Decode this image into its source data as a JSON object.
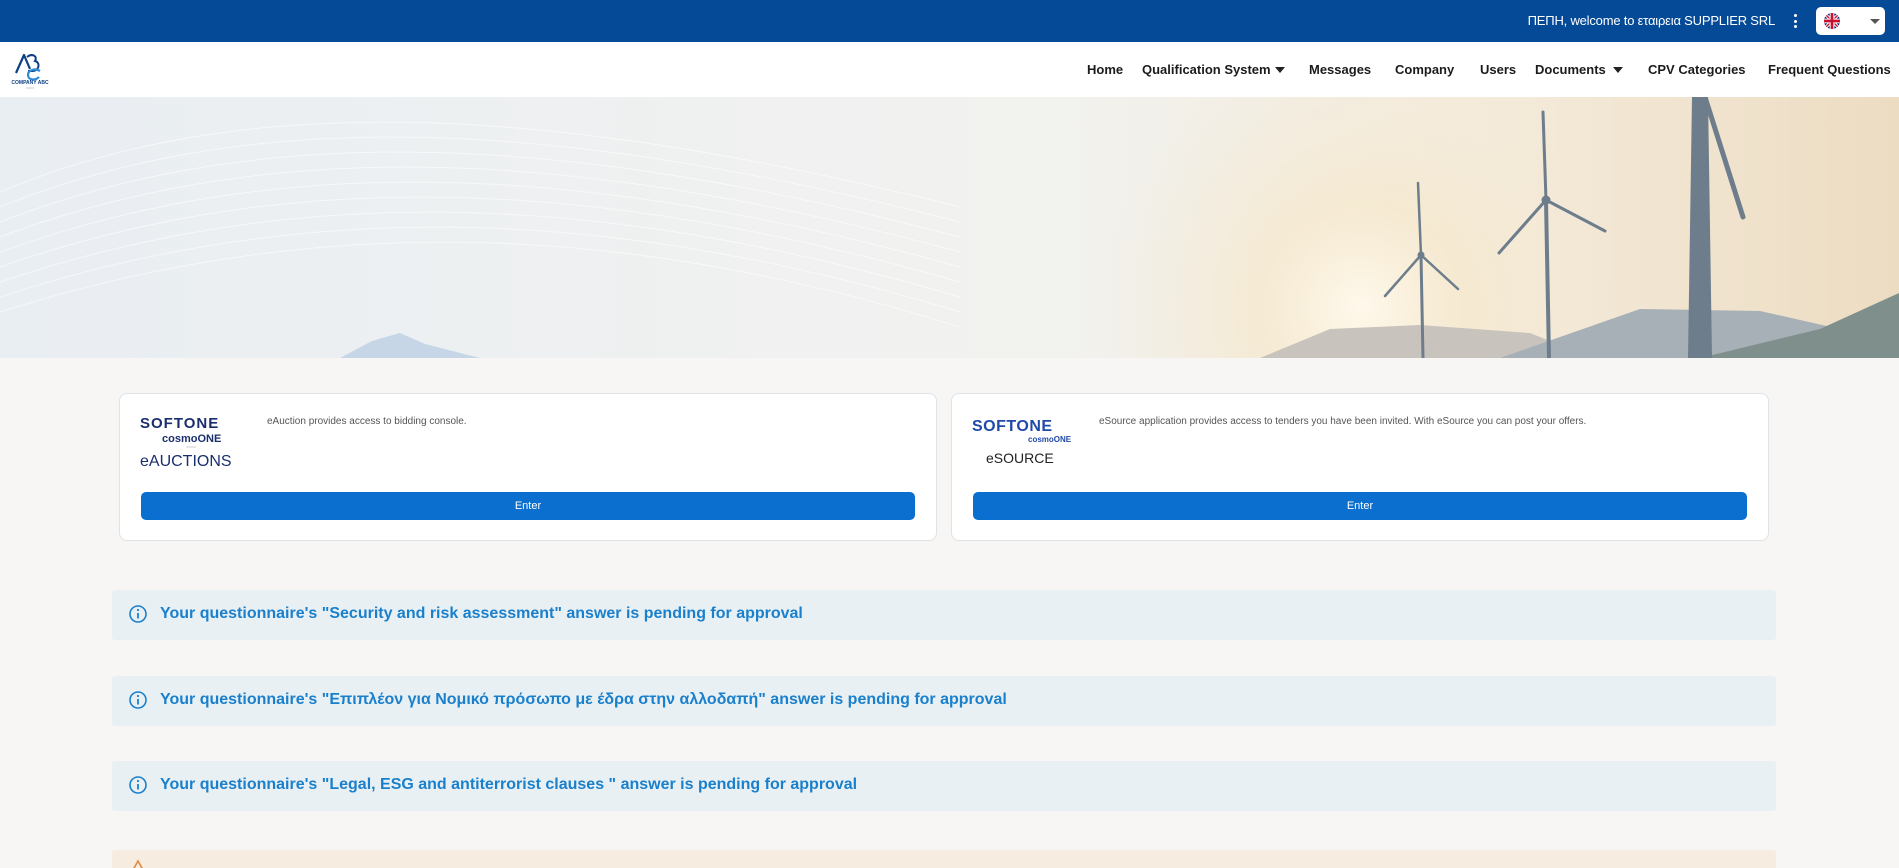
{
  "header": {
    "welcome_text": "ΠΕΠΗ, welcome to εταιρεια SUPPLIER SRL",
    "language": "English",
    "flag_icon": "uk-flag-icon",
    "brand_color": "#054a96"
  },
  "logo": {
    "text": "COMPANY ABC"
  },
  "nav": {
    "home": "Home",
    "qualification": "Qualification System",
    "messages": "Messages",
    "company": "Company",
    "users": "Users",
    "documents": "Documents",
    "cpv": "CPV Categories",
    "faq": "Frequent Questions"
  },
  "apps": [
    {
      "brand": "SOFTONE",
      "sub": "cosmoONE",
      "product": "eAUCTIONS",
      "description": "eAuction provides access to bidding console.",
      "button": "Enter"
    },
    {
      "brand": "SOFTONE",
      "sub": "cosmoONE",
      "product": "eSOURCE",
      "description": "eSource application provides access to tenders you have been invited. With eSource you can post your offers.",
      "button": "Enter"
    }
  ],
  "alerts": [
    {
      "text": "Your questionnaire's \"Security and risk assessment\" answer is pending for approval",
      "icon": "info-icon"
    },
    {
      "text": "Your questionnaire's \"Επιπλέον για Νομικό πρόσωπο με έδρα στην αλλοδαπή\" answer is pending for approval",
      "icon": "info-icon"
    },
    {
      "text": "Your questionnaire's \"Legal, ESG and antiterrorist clauses \" answer is pending for approval",
      "icon": "info-icon"
    }
  ],
  "colors": {
    "accent": "#0a6fcf",
    "alert_text": "#1a80cc",
    "alert_bg": "#e9f0f4",
    "warning_bg": "#f6ece0"
  }
}
